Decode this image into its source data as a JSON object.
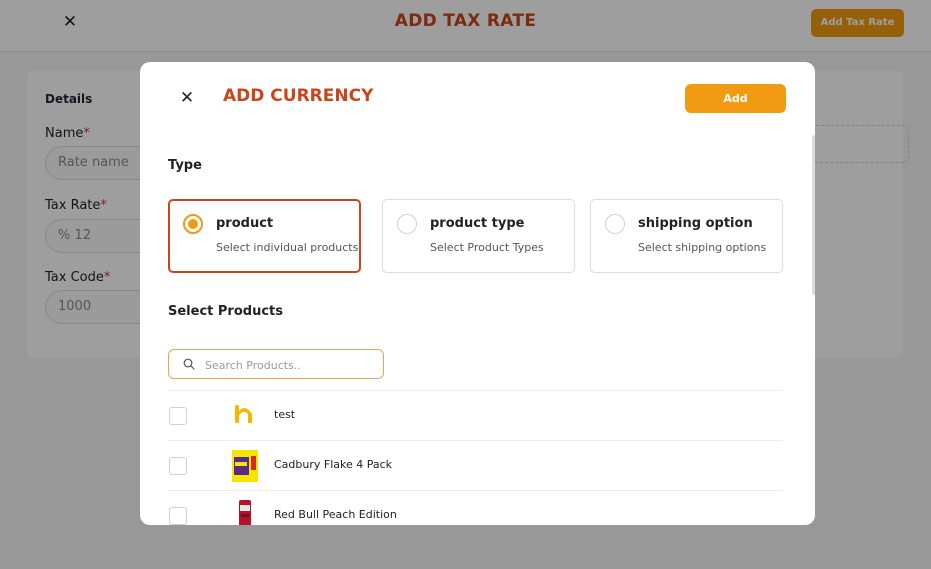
{
  "background": {
    "title": "ADD TAX RATE",
    "add_button": "Add Tax Rate",
    "details_heading": "Details",
    "fields": [
      {
        "label": "Name",
        "required_mark": "*",
        "placeholder": "Rate name",
        "value": ""
      },
      {
        "label": "Tax Rate",
        "required_mark": "*",
        "placeholder": "",
        "value": "% 12"
      },
      {
        "label": "Tax Code",
        "required_mark": "*",
        "placeholder": "",
        "value": "1000"
      }
    ]
  },
  "modal": {
    "title": "ADD CURRENCY",
    "add_button": "Add",
    "type_label": "Type",
    "type_options": [
      {
        "title": "product",
        "subtitle": "Select individual products",
        "selected": true
      },
      {
        "title": "product type",
        "subtitle": "Select Product Types",
        "selected": false
      },
      {
        "title": "shipping option",
        "subtitle": "Select shipping options",
        "selected": false
      }
    ],
    "select_products_label": "Select Products",
    "search": {
      "placeholder": "Search Products..",
      "value": ""
    },
    "products": [
      {
        "name": "test",
        "checked": false,
        "thumb": "orange-h-logo"
      },
      {
        "name": "Cadbury Flake 4 Pack",
        "checked": false,
        "thumb": "cadbury-flake-pack"
      },
      {
        "name": "Red Bull Peach Edition",
        "checked": false,
        "thumb": "red-bull-can"
      }
    ]
  },
  "colors": {
    "accent": "#f29b12",
    "title": "#c8461b",
    "selected_border": "#c8461b"
  }
}
